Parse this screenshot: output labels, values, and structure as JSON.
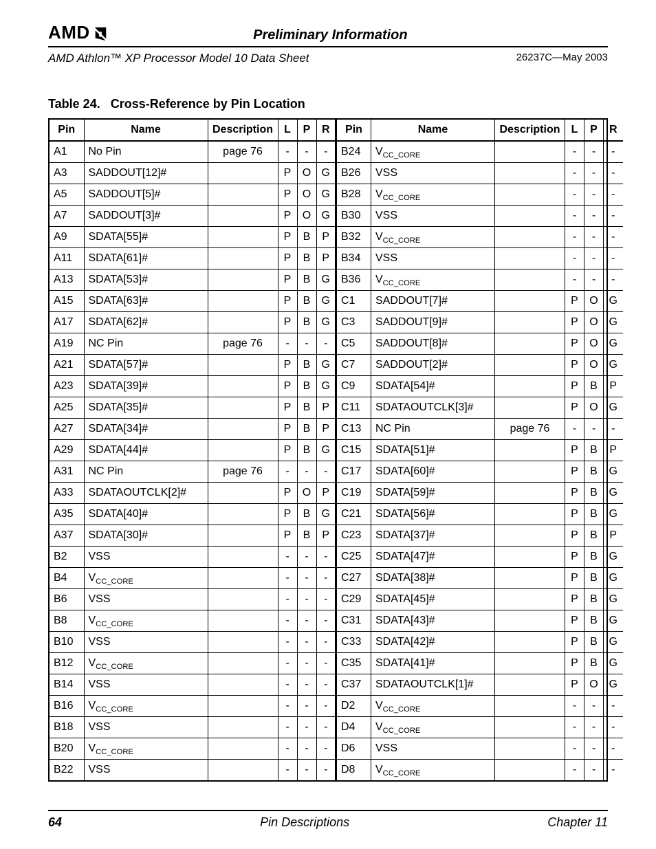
{
  "header": {
    "brand": "AMD",
    "preliminary": "Preliminary Information",
    "doc_title": "AMD Athlon™ XP Processor Model 10 Data Sheet",
    "doc_id": "26237C—May 2003"
  },
  "table": {
    "caption_prefix": "Table 24.",
    "caption_title": "Cross-Reference by Pin Location",
    "headers": {
      "pin": "Pin",
      "name": "Name",
      "desc": "Description",
      "l": "L",
      "p": "P",
      "r": "R"
    },
    "left": [
      {
        "pin": "A1",
        "name": "No Pin",
        "desc": "page 76",
        "l": "-",
        "p": "-",
        "r": "-"
      },
      {
        "pin": "A3",
        "name": "SADDOUT[12]#",
        "desc": "",
        "l": "P",
        "p": "O",
        "r": "G"
      },
      {
        "pin": "A5",
        "name": "SADDOUT[5]#",
        "desc": "",
        "l": "P",
        "p": "O",
        "r": "G"
      },
      {
        "pin": "A7",
        "name": "SADDOUT[3]#",
        "desc": "",
        "l": "P",
        "p": "O",
        "r": "G"
      },
      {
        "pin": "A9",
        "name": "SDATA[55]#",
        "desc": "",
        "l": "P",
        "p": "B",
        "r": "P"
      },
      {
        "pin": "A11",
        "name": "SDATA[61]#",
        "desc": "",
        "l": "P",
        "p": "B",
        "r": "P"
      },
      {
        "pin": "A13",
        "name": "SDATA[53]#",
        "desc": "",
        "l": "P",
        "p": "B",
        "r": "G"
      },
      {
        "pin": "A15",
        "name": "SDATA[63]#",
        "desc": "",
        "l": "P",
        "p": "B",
        "r": "G"
      },
      {
        "pin": "A17",
        "name": "SDATA[62]#",
        "desc": "",
        "l": "P",
        "p": "B",
        "r": "G"
      },
      {
        "pin": "A19",
        "name": "NC Pin",
        "desc": "page 76",
        "l": "-",
        "p": "-",
        "r": "-"
      },
      {
        "pin": "A21",
        "name": "SDATA[57]#",
        "desc": "",
        "l": "P",
        "p": "B",
        "r": "G"
      },
      {
        "pin": "A23",
        "name": "SDATA[39]#",
        "desc": "",
        "l": "P",
        "p": "B",
        "r": "G"
      },
      {
        "pin": "A25",
        "name": "SDATA[35]#",
        "desc": "",
        "l": "P",
        "p": "B",
        "r": "P"
      },
      {
        "pin": "A27",
        "name": "SDATA[34]#",
        "desc": "",
        "l": "P",
        "p": "B",
        "r": "P"
      },
      {
        "pin": "A29",
        "name": "SDATA[44]#",
        "desc": "",
        "l": "P",
        "p": "B",
        "r": "G"
      },
      {
        "pin": "A31",
        "name": "NC Pin",
        "desc": "page 76",
        "l": "-",
        "p": "-",
        "r": "-"
      },
      {
        "pin": "A33",
        "name": "SDATAOUTCLK[2]#",
        "desc": "",
        "l": "P",
        "p": "O",
        "r": "P"
      },
      {
        "pin": "A35",
        "name": "SDATA[40]#",
        "desc": "",
        "l": "P",
        "p": "B",
        "r": "G"
      },
      {
        "pin": "A37",
        "name": "SDATA[30]#",
        "desc": "",
        "l": "P",
        "p": "B",
        "r": "P"
      },
      {
        "pin": "B2",
        "name": "VSS",
        "desc": "",
        "l": "-",
        "p": "-",
        "r": "-"
      },
      {
        "pin": "B4",
        "name": "V_CC_CORE",
        "desc": "",
        "l": "-",
        "p": "-",
        "r": "-"
      },
      {
        "pin": "B6",
        "name": "VSS",
        "desc": "",
        "l": "-",
        "p": "-",
        "r": "-"
      },
      {
        "pin": "B8",
        "name": "V_CC_CORE",
        "desc": "",
        "l": "-",
        "p": "-",
        "r": "-"
      },
      {
        "pin": "B10",
        "name": "VSS",
        "desc": "",
        "l": "-",
        "p": "-",
        "r": "-"
      },
      {
        "pin": "B12",
        "name": "V_CC_CORE",
        "desc": "",
        "l": "-",
        "p": "-",
        "r": "-"
      },
      {
        "pin": "B14",
        "name": "VSS",
        "desc": "",
        "l": "-",
        "p": "-",
        "r": "-"
      },
      {
        "pin": "B16",
        "name": "V_CC_CORE",
        "desc": "",
        "l": "-",
        "p": "-",
        "r": "-"
      },
      {
        "pin": "B18",
        "name": "VSS",
        "desc": "",
        "l": "-",
        "p": "-",
        "r": "-"
      },
      {
        "pin": "B20",
        "name": "V_CC_CORE",
        "desc": "",
        "l": "-",
        "p": "-",
        "r": "-"
      },
      {
        "pin": "B22",
        "name": "VSS",
        "desc": "",
        "l": "-",
        "p": "-",
        "r": "-"
      }
    ],
    "right": [
      {
        "pin": "B24",
        "name": "V_CC_CORE",
        "desc": "",
        "l": "-",
        "p": "-",
        "r": "-"
      },
      {
        "pin": "B26",
        "name": "VSS",
        "desc": "",
        "l": "-",
        "p": "-",
        "r": "-"
      },
      {
        "pin": "B28",
        "name": "V_CC_CORE",
        "desc": "",
        "l": "-",
        "p": "-",
        "r": "-"
      },
      {
        "pin": "B30",
        "name": "VSS",
        "desc": "",
        "l": "-",
        "p": "-",
        "r": "-"
      },
      {
        "pin": "B32",
        "name": "V_CC_CORE",
        "desc": "",
        "l": "-",
        "p": "-",
        "r": "-"
      },
      {
        "pin": "B34",
        "name": "VSS",
        "desc": "",
        "l": "-",
        "p": "-",
        "r": "-"
      },
      {
        "pin": "B36",
        "name": "V_CC_CORE",
        "desc": "",
        "l": "-",
        "p": "-",
        "r": "-"
      },
      {
        "pin": "C1",
        "name": "SADDOUT[7]#",
        "desc": "",
        "l": "P",
        "p": "O",
        "r": "G"
      },
      {
        "pin": "C3",
        "name": "SADDOUT[9]#",
        "desc": "",
        "l": "P",
        "p": "O",
        "r": "G"
      },
      {
        "pin": "C5",
        "name": "SADDOUT[8]#",
        "desc": "",
        "l": "P",
        "p": "O",
        "r": "G"
      },
      {
        "pin": "C7",
        "name": "SADDOUT[2]#",
        "desc": "",
        "l": "P",
        "p": "O",
        "r": "G"
      },
      {
        "pin": "C9",
        "name": "SDATA[54]#",
        "desc": "",
        "l": "P",
        "p": "B",
        "r": "P"
      },
      {
        "pin": "C11",
        "name": "SDATAOUTCLK[3]#",
        "desc": "",
        "l": "P",
        "p": "O",
        "r": "G"
      },
      {
        "pin": "C13",
        "name": "NC Pin",
        "desc": "page 76",
        "l": "-",
        "p": "-",
        "r": "-"
      },
      {
        "pin": "C15",
        "name": "SDATA[51]#",
        "desc": "",
        "l": "P",
        "p": "B",
        "r": "P"
      },
      {
        "pin": "C17",
        "name": "SDATA[60]#",
        "desc": "",
        "l": "P",
        "p": "B",
        "r": "G"
      },
      {
        "pin": "C19",
        "name": "SDATA[59]#",
        "desc": "",
        "l": "P",
        "p": "B",
        "r": "G"
      },
      {
        "pin": "C21",
        "name": "SDATA[56]#",
        "desc": "",
        "l": "P",
        "p": "B",
        "r": "G"
      },
      {
        "pin": "C23",
        "name": "SDATA[37]#",
        "desc": "",
        "l": "P",
        "p": "B",
        "r": "P"
      },
      {
        "pin": "C25",
        "name": "SDATA[47]#",
        "desc": "",
        "l": "P",
        "p": "B",
        "r": "G"
      },
      {
        "pin": "C27",
        "name": "SDATA[38]#",
        "desc": "",
        "l": "P",
        "p": "B",
        "r": "G"
      },
      {
        "pin": "C29",
        "name": "SDATA[45]#",
        "desc": "",
        "l": "P",
        "p": "B",
        "r": "G"
      },
      {
        "pin": "C31",
        "name": "SDATA[43]#",
        "desc": "",
        "l": "P",
        "p": "B",
        "r": "G"
      },
      {
        "pin": "C33",
        "name": "SDATA[42]#",
        "desc": "",
        "l": "P",
        "p": "B",
        "r": "G"
      },
      {
        "pin": "C35",
        "name": "SDATA[41]#",
        "desc": "",
        "l": "P",
        "p": "B",
        "r": "G"
      },
      {
        "pin": "C37",
        "name": "SDATAOUTCLK[1]#",
        "desc": "",
        "l": "P",
        "p": "O",
        "r": "G"
      },
      {
        "pin": "D2",
        "name": "V_CC_CORE",
        "desc": "",
        "l": "-",
        "p": "-",
        "r": "-"
      },
      {
        "pin": "D4",
        "name": "V_CC_CORE",
        "desc": "",
        "l": "-",
        "p": "-",
        "r": "-"
      },
      {
        "pin": "D6",
        "name": "VSS",
        "desc": "",
        "l": "-",
        "p": "-",
        "r": "-"
      },
      {
        "pin": "D8",
        "name": "V_CC_CORE",
        "desc": "",
        "l": "-",
        "p": "-",
        "r": "-"
      }
    ]
  },
  "footer": {
    "page_number": "64",
    "section": "Pin Descriptions",
    "chapter": "Chapter 11"
  }
}
